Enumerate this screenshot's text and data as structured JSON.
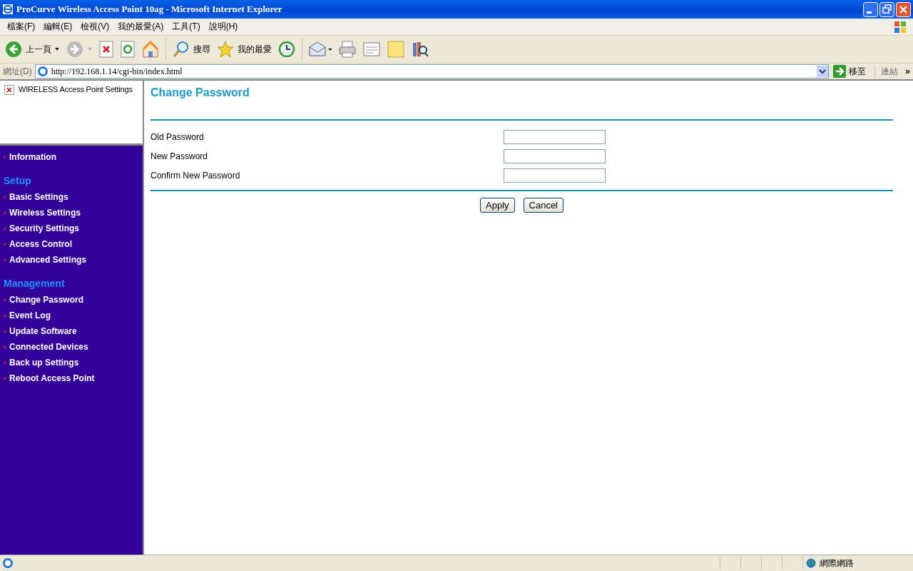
{
  "window": {
    "title": "ProCurve Wireless Access Point 10ag - Microsoft Internet Explorer"
  },
  "menu": [
    "檔案(F)",
    "編輯(E)",
    "檢視(V)",
    "我的最愛(A)",
    "工具(T)",
    "說明(H)"
  ],
  "toolbar": [
    {
      "kind": "back",
      "label": "上一頁"
    },
    {
      "kind": "forward"
    },
    {
      "kind": "stop"
    },
    {
      "kind": "refresh"
    },
    {
      "kind": "home"
    },
    {
      "kind": "search",
      "label": "搜尋"
    },
    {
      "kind": "favorites",
      "label": "我的最愛"
    },
    {
      "kind": "history"
    },
    {
      "kind": "mail"
    },
    {
      "kind": "print"
    },
    {
      "kind": "edit"
    },
    {
      "kind": "note"
    },
    {
      "kind": "research"
    }
  ],
  "address_bar": {
    "label": "網址(D)",
    "url": "http://192.168.1.14/cgi-bin/index.html",
    "go": "移至",
    "links": "連結",
    "more": "»"
  },
  "sidebar": {
    "banner": "WIRELESS Access Point Settings",
    "groups": [
      {
        "items": [
          "Information"
        ]
      },
      {
        "heading": "Setup",
        "items": [
          "Basic Settings",
          "Wireless Settings",
          "Security Settings",
          "Access Control",
          "Advanced Settings"
        ]
      },
      {
        "heading": "Management",
        "items": [
          "Change Password",
          "Event Log",
          "Update Software",
          "Connected Devices",
          "Back up Settings",
          "Reboot Access Point"
        ]
      }
    ]
  },
  "main": {
    "title": "Change Password",
    "fields": [
      {
        "label": "Old Password"
      },
      {
        "label": "New Password"
      },
      {
        "label": "Confirm New Password"
      }
    ],
    "buttons": [
      "Apply",
      "Cancel"
    ]
  },
  "status_bar": {
    "zone": "網際網路"
  }
}
